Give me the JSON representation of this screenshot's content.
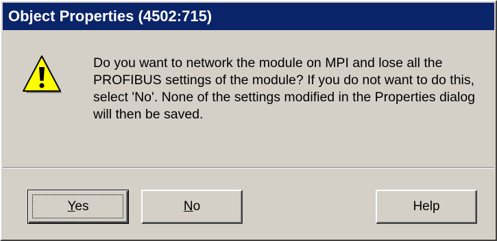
{
  "dialog": {
    "title": "Object Properties (4502:715)",
    "icon": "warning-icon",
    "message": "Do you want to network the module on MPI and lose all the PROFIBUS settings of the module? If you do not want to do this, select 'No'. None of the settings modified in the Properties dialog will then be saved."
  },
  "buttons": {
    "yes": {
      "mnemonic": "Y",
      "rest": "es"
    },
    "no": {
      "mnemonic": "N",
      "rest": "o"
    },
    "help": {
      "label": "Help"
    }
  },
  "colors": {
    "titlebar": "#0a246a",
    "face": "#d4d0c8",
    "warning_yellow": "#ffff00"
  }
}
